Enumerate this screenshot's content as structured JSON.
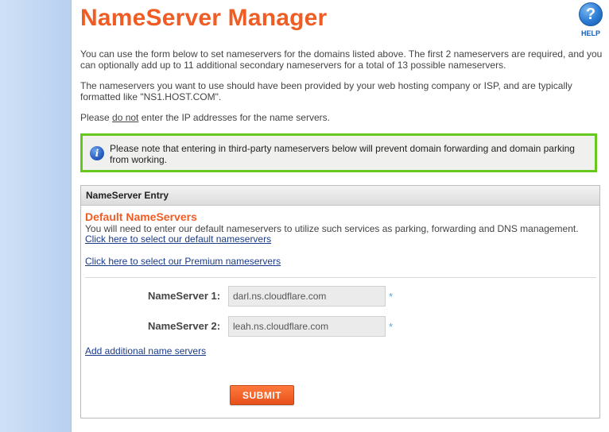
{
  "page": {
    "title": "NameServer Manager",
    "help_label": "HELP",
    "help_icon": "?"
  },
  "intro": {
    "p1": "You can use the form below to set nameservers for the domains listed above. The first 2 nameservers are required, and you can optionally add up to 11 additional secondary nameservers for a total of 13 possible nameservers.",
    "p2": "The nameservers you want to use should have been provided by your web hosting company or ISP, and are typically formatted like \"NS1.HOST.COM\".",
    "p3_before": "Please ",
    "p3_emphasis": "do not",
    "p3_after": " enter the IP addresses for the name servers."
  },
  "notice": {
    "icon": "info-icon",
    "text": "Please note that entering in third-party nameservers below will prevent domain forwarding and domain parking from working."
  },
  "panel": {
    "header": "NameServer Entry",
    "section_title": "Default NameServers",
    "section_desc": "You will need to enter our default nameservers to utilize such services as parking, forwarding and DNS management.",
    "link_default": "Click here to select our default nameservers",
    "link_premium": "Click here to select our Premium nameservers",
    "ns1_label": "NameServer 1:",
    "ns1_value": "darl.ns.cloudflare.com",
    "ns2_label": "NameServer 2:",
    "ns2_value": "leah.ns.cloudflare.com",
    "required_mark": "*",
    "link_add": "Add additional name servers",
    "submit_label": "SUBMIT"
  },
  "colors": {
    "accent": "#ef5d24",
    "notice_border": "#66c81c",
    "link": "#1a3a8a"
  }
}
